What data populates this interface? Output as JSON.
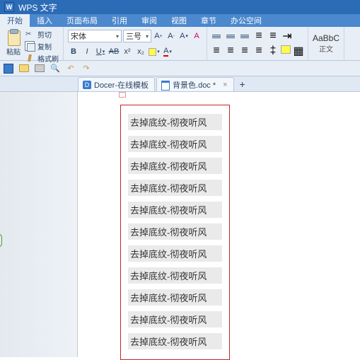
{
  "app": {
    "name": "WPS 文字"
  },
  "menu": {
    "items": [
      "开始",
      "插入",
      "页面布局",
      "引用",
      "审阅",
      "视图",
      "章节",
      "办公空间"
    ],
    "active_index": 0
  },
  "ribbon": {
    "paste": {
      "label": "粘贴",
      "cut": "剪切",
      "copy": "复制",
      "format_painter": "格式刷"
    },
    "font": {
      "name": "宋体",
      "size": "三号"
    },
    "style": {
      "preview": "AaBbC",
      "label": "正文"
    }
  },
  "tabs": {
    "items": [
      {
        "label": "Docer-在线模板",
        "icon": "docer",
        "closable": false
      },
      {
        "label": "背景色.doc *",
        "icon": "doc",
        "closable": true
      }
    ]
  },
  "document": {
    "lines": [
      "去掉底纹-彻夜听风",
      "去掉底纹-彻夜听风",
      "去掉底纹-彻夜听风",
      "去掉底纹-彻夜听风",
      "去掉底纹-彻夜听风",
      "去掉底纹-彻夜听风",
      "去掉底纹-彻夜听风",
      "去掉底纹-彻夜听风",
      "去掉底纹-彻夜听风",
      "去掉底纹-彻夜听风",
      "去掉底纹-彻夜听风"
    ]
  }
}
